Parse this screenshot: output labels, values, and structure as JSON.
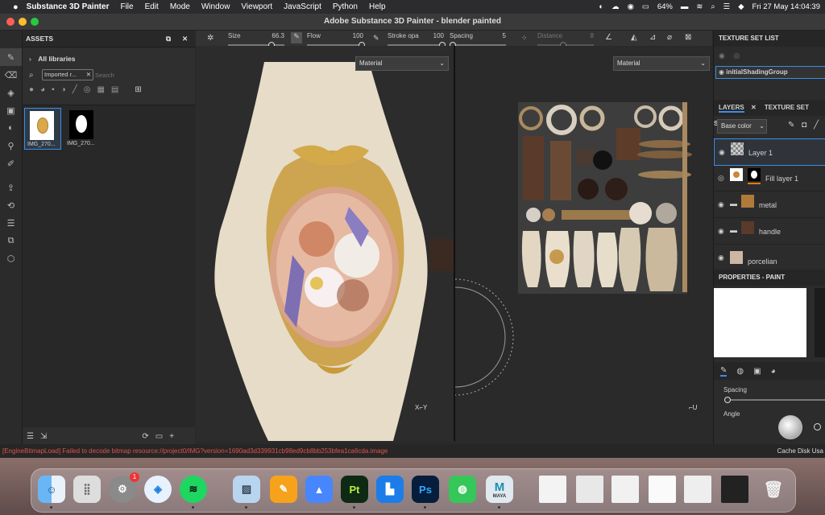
{
  "menubar": {
    "app_name": "Substance 3D Painter",
    "items": [
      "File",
      "Edit",
      "Mode",
      "Window",
      "Viewport",
      "JavaScript",
      "Python",
      "Help"
    ],
    "battery": "64%",
    "datetime": "Fri 27 May  14:04:39"
  },
  "window": {
    "title": "Adobe Substance 3D Painter - blender painted"
  },
  "assets": {
    "title": "ASSETS",
    "all_libraries": "All libraries",
    "filter_chip": "Imported r...",
    "search_placeholder": "Search",
    "thumbs": [
      "IMG_270...",
      "IMG_270..."
    ]
  },
  "brush": {
    "size_label": "Size",
    "size_value": "66.3",
    "flow_label": "Flow",
    "flow_value": "100",
    "stroke_label": "Stroke opa",
    "stroke_value": "100",
    "spacing_label": "Spacing",
    "spacing_value": "5",
    "distance_label": "Distance",
    "distance_value": "8"
  },
  "viewport": {
    "left_mode": "Material",
    "right_mode": "Material"
  },
  "texture_set": {
    "title": "TEXTURE SET LIST",
    "item": "initialShadingGroup"
  },
  "layers": {
    "tab_layers": "LAYERS",
    "tab_texture_settings": "TEXTURE SET SETT",
    "channel": "Base color",
    "items": [
      "Layer 1",
      "Fill layer 1",
      "metal",
      "handle",
      "porcelian"
    ]
  },
  "properties": {
    "title": "PROPERTIES - PAINT",
    "spacing_label": "Spacing",
    "angle_label": "Angle"
  },
  "status": {
    "error": "[EngineBitmapLoad] Failed to decode bitmap resource://project0/IMG?version=1690ad3d339931cb98ed9cb8bb253bfea1ca6cda.image",
    "cache": "Cache Disk Usa"
  },
  "dock": {
    "settings_badge": "1",
    "maya_label": "MAYA",
    "pt_label": "Pt",
    "ps_label": "Ps"
  },
  "colors": {
    "accent": "#3a8ee6",
    "error": "#e0524a",
    "orange": "#e07b1a"
  }
}
